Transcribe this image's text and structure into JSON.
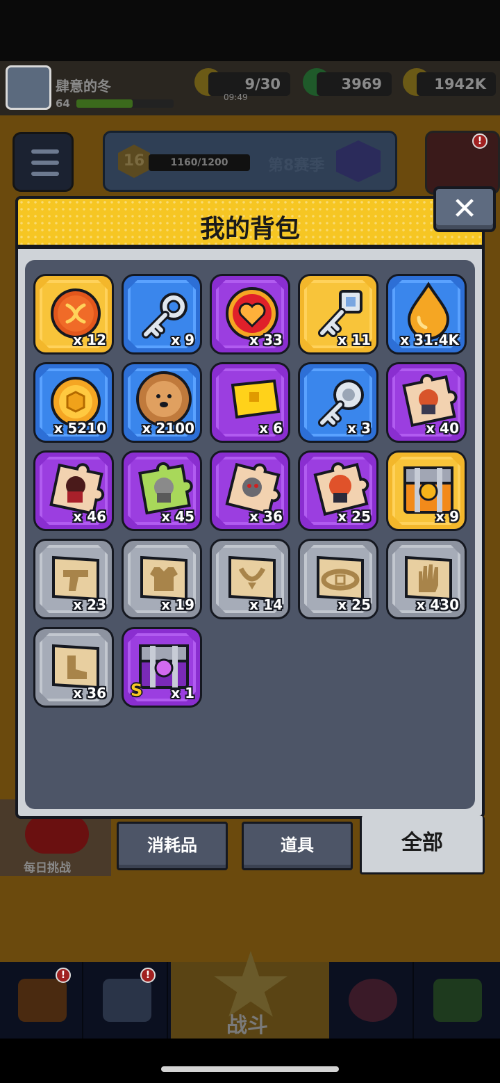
{
  "hud": {
    "player_name": "肆意的冬",
    "player_level": "64",
    "energy": "9/30",
    "energy_timer": "09:49",
    "gems": "3969",
    "coins": "1942K"
  },
  "season": {
    "level": "16",
    "progress": "1160/1200",
    "title": "第8赛季"
  },
  "daily_challenge": {
    "label": "每日挑战"
  },
  "modal": {
    "title": "我的背包",
    "close_label": "✕"
  },
  "inventory": {
    "items": [
      {
        "name": "dna-orb",
        "rarity": "orange",
        "qty": "x 12"
      },
      {
        "name": "silver-key",
        "rarity": "blue",
        "qty": "x 9"
      },
      {
        "name": "heart-token",
        "rarity": "purple",
        "qty": "x 33"
      },
      {
        "name": "gold-key",
        "rarity": "orange",
        "qty": "x 11"
      },
      {
        "name": "gold-drop",
        "rarity": "blue",
        "qty": "x 31.4K"
      },
      {
        "name": "gold-coin",
        "rarity": "blue",
        "qty": "x 5210"
      },
      {
        "name": "dog-cookie",
        "rarity": "blue",
        "qty": "x 2100"
      },
      {
        "name": "gold-ticket",
        "rarity": "purple",
        "qty": "x 6"
      },
      {
        "name": "cat-key",
        "rarity": "blue",
        "qty": "x 3"
      },
      {
        "name": "hero-puzzle-1",
        "rarity": "purple",
        "qty": "x 40"
      },
      {
        "name": "hero-puzzle-2",
        "rarity": "purple",
        "qty": "x 46"
      },
      {
        "name": "hero-puzzle-3",
        "rarity": "purple",
        "qty": "x 45"
      },
      {
        "name": "hero-puzzle-4",
        "rarity": "purple",
        "qty": "x 36"
      },
      {
        "name": "hero-puzzle-5",
        "rarity": "purple",
        "qty": "x 25"
      },
      {
        "name": "orange-chest",
        "rarity": "orange",
        "qty": "x 9"
      },
      {
        "name": "gun-blueprint",
        "rarity": "gray",
        "qty": "x 23"
      },
      {
        "name": "armor-blueprint",
        "rarity": "gray",
        "qty": "x 19"
      },
      {
        "name": "necklace-blueprint",
        "rarity": "gray",
        "qty": "x 14"
      },
      {
        "name": "belt-blueprint",
        "rarity": "gray",
        "qty": "x 25"
      },
      {
        "name": "glove-blueprint",
        "rarity": "gray",
        "qty": "x 430"
      },
      {
        "name": "boots-blueprint",
        "rarity": "gray",
        "qty": "x 36"
      },
      {
        "name": "purple-chest-s",
        "rarity": "purple",
        "qty": "x 1",
        "badge": "S"
      }
    ]
  },
  "tabs": {
    "consumables": "消耗品",
    "props": "道具",
    "all": "全部"
  },
  "bottom_nav": {
    "fight": "战斗"
  }
}
